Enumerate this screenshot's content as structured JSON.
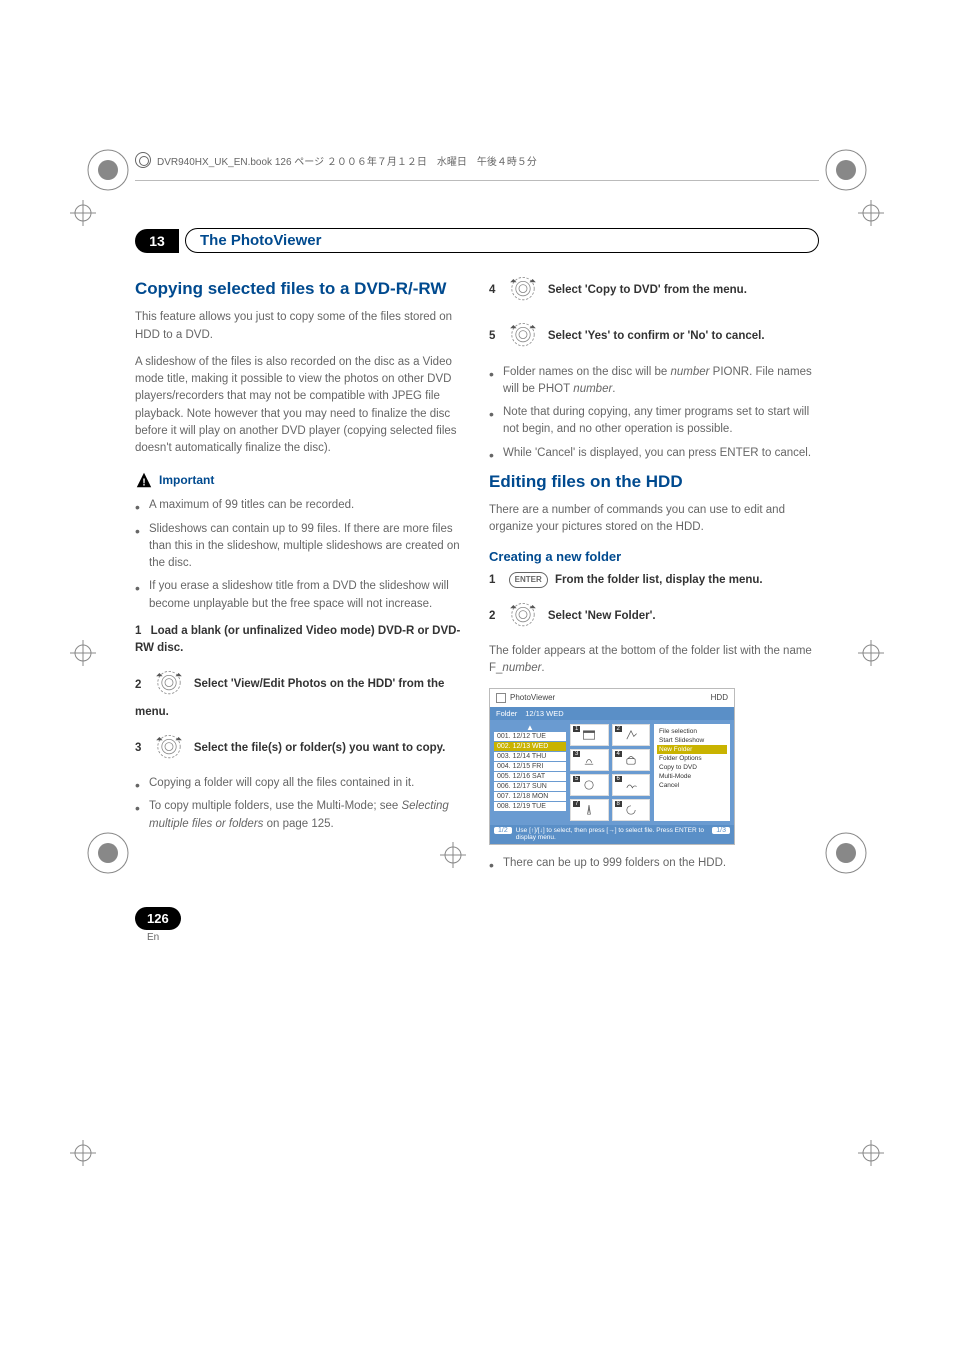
{
  "header": {
    "text": "DVR940HX_UK_EN.book  126 ページ  ２００６年７月１２日　水曜日　午後４時５分"
  },
  "chapter": {
    "number": "13",
    "title": "The PhotoViewer"
  },
  "left": {
    "h2": "Copying selected files to a DVD-R/-RW",
    "p1": "This feature allows you just to copy some of the files stored on HDD to a DVD.",
    "p2": "A slideshow of the files is also recorded on the disc as a Video mode title, making it possible to view the photos on other DVD players/recorders that may not be compatible with JPEG file playback. Note however that you may need to finalize the disc before it will play on another DVD player (copying selected files doesn't automatically finalize the disc).",
    "important_label": "Important",
    "important_items": [
      "A maximum of 99 titles can be recorded.",
      "Slideshows can contain up to 99 files. If there are more files than this in the slideshow, multiple slideshows are created on the disc.",
      "If you erase a slideshow title from a DVD the slideshow will become unplayable but the free space will not increase."
    ],
    "step1_num": "1",
    "step1": "Load a blank (or unfinalized Video mode) DVD-R or DVD-RW disc.",
    "step2_num": "2",
    "step2": "Select 'View/Edit Photos on the HDD' from the menu.",
    "step3_num": "3",
    "step3": "Select the file(s) or folder(s) you want to copy.",
    "step3_bul": [
      "Copying a folder will copy all the files contained in it.",
      "To copy multiple folders, use the Multi-Mode; see "
    ],
    "step3_ref": "Selecting multiple files or folders",
    "step3_ref_tail": " on page 125."
  },
  "right": {
    "step4_num": "4",
    "step4": "Select 'Copy to DVD' from the menu.",
    "step5_num": "5",
    "step5": "Select 'Yes' to confirm or 'No' to cancel.",
    "step5_bul_a_pre": "Folder names on the disc will be ",
    "step5_bul_a_num": "number",
    "step5_bul_a_mid": " PIONR",
    "step5_bul_a_post": ". File names will be ",
    "step5_bul_a_phot": "PHOT",
    "step5_bul_a_num2": " number",
    "step5_bul_a_end": ".",
    "step5_bul_b": "Note that during copying, any timer programs set to start will not begin, and no other operation is possible.",
    "step5_bul_c_pre": "While ",
    "step5_bul_c_cancel": "'Cancel'",
    "step5_bul_c_mid": " is displayed, you can press ",
    "step5_bul_c_enter": "ENTER",
    "step5_bul_c_end": " to cancel.",
    "h2": "Editing files on the HDD",
    "p1": "There are a number of commands you can use to edit and organize your pictures stored on the HDD.",
    "h3": "Creating a new folder",
    "cf_step1_num": "1",
    "cf_step1_enter": "ENTER",
    "cf_step1": "From the folder list, display the menu.",
    "cf_step2_num": "2",
    "cf_step2": "Select 'New Folder'.",
    "cf_desc_pre": "The folder appears at the bottom of the folder list with the name ",
    "cf_desc_bold": "F_",
    "cf_desc_ital": "number",
    "cf_desc_end": ".",
    "cf_bul": "There can be up to 999 folders on the HDD."
  },
  "ui": {
    "title": "PhotoViewer",
    "src": "HDD",
    "folder_label": "Folder",
    "folder_date": "12/13 WED",
    "folders": [
      "001. 12/12 TUE",
      "002. 12/13 WED",
      "003. 12/14 THU",
      "004. 12/15 FRI",
      "005. 12/16 SAT",
      "006. 12/17 SUN",
      "007. 12/18 MON",
      "008. 12/19 TUE"
    ],
    "thumb_nums": [
      "1",
      "2",
      "3",
      "4",
      "5",
      "6",
      "7",
      "8"
    ],
    "menu": [
      "File selection",
      "Start Slideshow",
      "New Folder",
      "Folder Options",
      "Copy to DVD",
      "Multi-Mode",
      "Cancel"
    ],
    "hint_left": "1/2",
    "hint_mid": "Use [↑]/[↓] to select, then press [→] to select file. Press ENTER to display menu.",
    "hint_right": "1/3"
  },
  "page": {
    "num": "126",
    "lang": "En"
  }
}
